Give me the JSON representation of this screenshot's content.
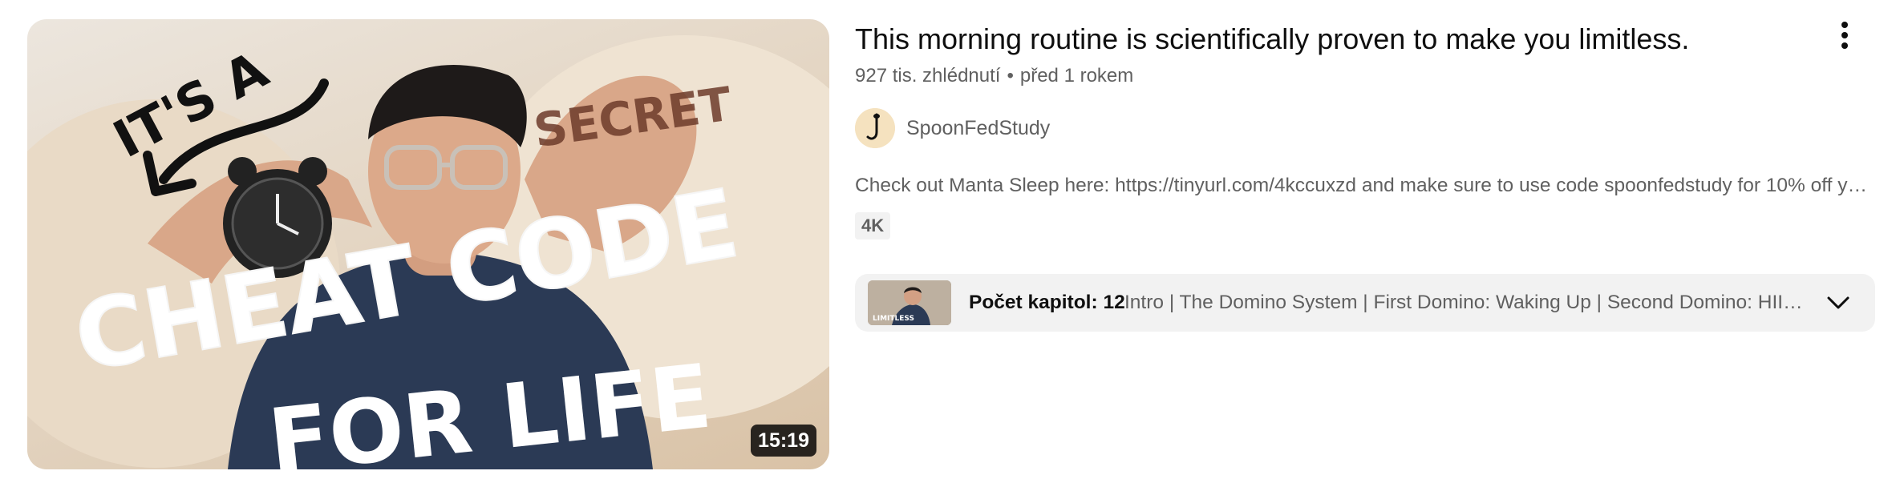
{
  "video": {
    "title": "This morning routine is scientifically proven to make you limitless.",
    "views": "927 tis. zhlédnutí",
    "separator": "•",
    "age": "před 1 rokem",
    "duration": "15:19",
    "channel": "SpoonFedStudy",
    "description": "Check out Manta Sleep here: https://tinyurl.com/4kccuxzd and make sure to use code spoonfedstudy for 10% off your...",
    "badge": "4K",
    "chapters": {
      "label": "Počet kapitol: 12",
      "list": "Intro | The Domino System | First Domino: Waking Up | Second Domino: HIIT | ..."
    },
    "thumbnail_text": {
      "line1": "IT'S A",
      "line2": "CHEAT CODE",
      "line3": "FOR LIFE",
      "arm": "SECRET"
    },
    "chapter_thumb_text": "LIMITLESS"
  },
  "icons": {
    "menu": "more-vert-icon",
    "expand": "chevron-down-icon"
  },
  "colors": {
    "title": "#0f0f0f",
    "secondary": "#606060",
    "chip_bg": "#f2f2f2",
    "shirt": "#2b3a55"
  }
}
